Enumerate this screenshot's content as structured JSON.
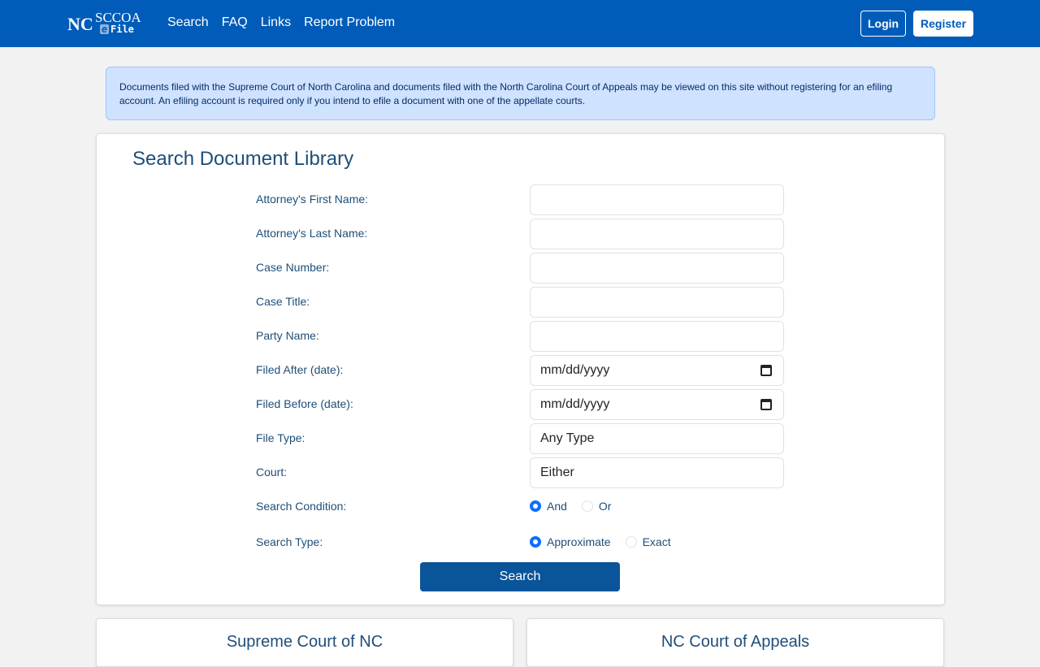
{
  "nav": {
    "logo": "NC SCCOA eFile",
    "logo_nc": "NC",
    "logo_sccoa": "SCCOA",
    "logo_e": "e",
    "logo_file": "File",
    "links": [
      "Search",
      "FAQ",
      "Links",
      "Report Problem"
    ],
    "login": "Login",
    "register": "Register"
  },
  "alert": "Documents filed with the Supreme Court of North Carolina and documents filed with the North Carolina Court of Appeals may be viewed on this site without registering for an efiling account. An efiling account is required only if you intend to efile a document with one of the appellate courts.",
  "form": {
    "title": "Search Document Library",
    "labels": [
      "Attorney's First Name:",
      "Attorney's Last Name:",
      "Case Number:",
      "Case Title:",
      "Party Name:",
      "Filed After (date):",
      "Filed Before (date):",
      "File Type:",
      "Court:",
      "Search Condition:",
      "Search Type:"
    ],
    "date_placeholder": "mm/dd/yyyy",
    "file_type": "Any Type",
    "court": "Either",
    "condition": {
      "options": [
        "And",
        "Or"
      ],
      "selected": "And"
    },
    "type": {
      "options": [
        "Approximate",
        "Exact"
      ],
      "selected": "Approximate"
    },
    "search": "Search"
  },
  "cards": [
    "Supreme Court of NC",
    "NC Court of Appeals"
  ]
}
